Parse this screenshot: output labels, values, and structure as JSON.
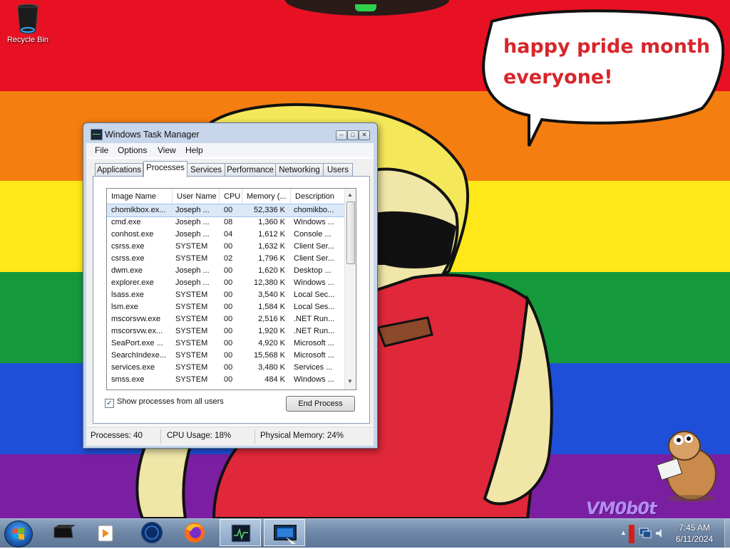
{
  "desktop": {
    "icons": [
      {
        "label": "Recycle Bin",
        "icon": "recycle-bin-icon"
      }
    ],
    "speech_bubble": {
      "line1": "happy pride month",
      "line2": "everyone!"
    },
    "watermark": "VM0b0t"
  },
  "window": {
    "title": "Windows Task Manager",
    "menu": [
      "File",
      "Options",
      "View",
      "Help"
    ],
    "tabs": [
      "Applications",
      "Processes",
      "Services",
      "Performance",
      "Networking",
      "Users"
    ],
    "active_tab": "Processes",
    "columns": [
      "Image Name",
      "User Name",
      "CPU",
      "Memory (...",
      "Description"
    ],
    "processes": [
      {
        "name": "chomikbox.ex...",
        "user": "Joseph ...",
        "cpu": "00",
        "memory": "52,336 K",
        "description": "chomikbo..."
      },
      {
        "name": "cmd.exe",
        "user": "Joseph ...",
        "cpu": "08",
        "memory": "1,360 K",
        "description": "Windows ..."
      },
      {
        "name": "conhost.exe",
        "user": "Joseph ...",
        "cpu": "04",
        "memory": "1,612 K",
        "description": "Console ..."
      },
      {
        "name": "csrss.exe",
        "user": "SYSTEM",
        "cpu": "00",
        "memory": "1,632 K",
        "description": "Client Ser..."
      },
      {
        "name": "csrss.exe",
        "user": "SYSTEM",
        "cpu": "02",
        "memory": "1,796 K",
        "description": "Client Ser..."
      },
      {
        "name": "dwm.exe",
        "user": "Joseph ...",
        "cpu": "00",
        "memory": "1,620 K",
        "description": "Desktop ..."
      },
      {
        "name": "explorer.exe",
        "user": "Joseph ...",
        "cpu": "00",
        "memory": "12,380 K",
        "description": "Windows ..."
      },
      {
        "name": "lsass.exe",
        "user": "SYSTEM",
        "cpu": "00",
        "memory": "3,540 K",
        "description": "Local Sec..."
      },
      {
        "name": "lsm.exe",
        "user": "SYSTEM",
        "cpu": "00",
        "memory": "1,584 K",
        "description": "Local Ses..."
      },
      {
        "name": "mscorsvw.exe",
        "user": "SYSTEM",
        "cpu": "00",
        "memory": "2,516 K",
        "description": ".NET Run..."
      },
      {
        "name": "mscorsvw.ex...",
        "user": "SYSTEM",
        "cpu": "00",
        "memory": "1,920 K",
        "description": ".NET Run..."
      },
      {
        "name": "SeaPort.exe ...",
        "user": "SYSTEM",
        "cpu": "00",
        "memory": "4,920 K",
        "description": "Microsoft ..."
      },
      {
        "name": "SearchIndexe...",
        "user": "SYSTEM",
        "cpu": "00",
        "memory": "15,568 K",
        "description": "Microsoft ..."
      },
      {
        "name": "services.exe",
        "user": "SYSTEM",
        "cpu": "00",
        "memory": "3,480 K",
        "description": "Services ..."
      },
      {
        "name": "smss.exe",
        "user": "SYSTEM",
        "cpu": "00",
        "memory": "484 K",
        "description": "Windows ..."
      }
    ],
    "selected_process": "chomikbox.ex...",
    "show_all_label": "Show processes from all users",
    "show_all_checked": true,
    "end_process_label": "End Process",
    "status": {
      "processes": "Processes: 40",
      "cpu": "CPU Usage: 18%",
      "memory": "Physical Memory: 24%"
    }
  },
  "taskbar": {
    "pinned": [
      "terminal-icon",
      "media-player-icon",
      "globe-icon",
      "firefox-icon",
      "task-manager-icon",
      "remote-desktop-icon"
    ],
    "clock": {
      "time": "7:45 AM",
      "date": "6/11/2024"
    }
  },
  "colors": {
    "red": "#e81123",
    "orange": "#f57e10",
    "yellow": "#ffe81a",
    "green": "#149a3a",
    "blue": "#1f4fd8",
    "purple": "#7b1fa2",
    "speech_text": "#d7262b"
  }
}
